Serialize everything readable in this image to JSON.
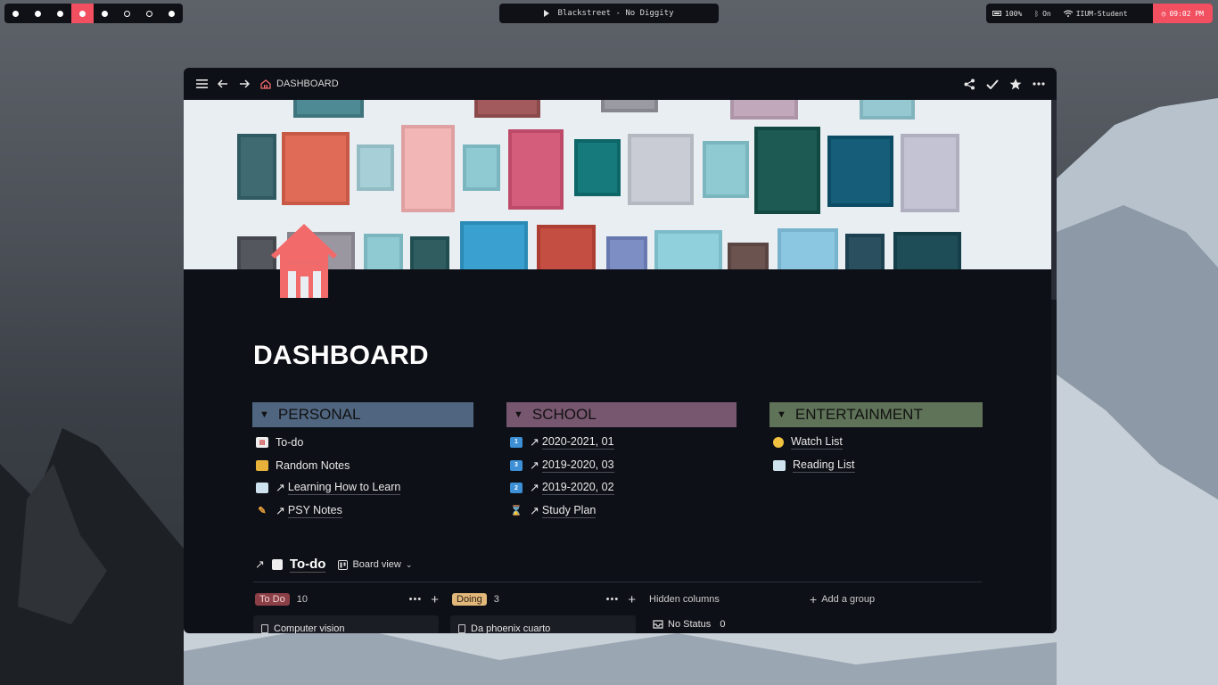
{
  "topbar": {
    "workspaces": [
      {
        "state": "filled"
      },
      {
        "state": "filled"
      },
      {
        "state": "filled"
      },
      {
        "state": "active"
      },
      {
        "state": "filled"
      },
      {
        "state": "hollow"
      },
      {
        "state": "hollow"
      },
      {
        "state": "filled"
      }
    ],
    "now_playing": "Blackstreet - No Diggity",
    "battery": "100%",
    "bluetooth": "On",
    "wifi": "IIUM-Student",
    "clock": "09:02 PM",
    "accent_color": "#f25060"
  },
  "window": {
    "breadcrumb": "DASHBOARD",
    "icons": [
      "menu-icon",
      "back-icon",
      "forward-icon",
      "home-icon",
      "share-icon",
      "check-icon",
      "star-icon",
      "more-icon"
    ]
  },
  "page": {
    "title": "DASHBOARD",
    "sections": [
      {
        "title": "PERSONAL",
        "color": "#4f6580",
        "items": [
          {
            "emoji": "clipboard-icon",
            "link": false,
            "label": "To-do"
          },
          {
            "emoji": "notebook-icon",
            "link": false,
            "label": "Random Notes"
          },
          {
            "emoji": "book-icon",
            "link": true,
            "label": "Learning How to Learn"
          },
          {
            "emoji": "pencil-icon",
            "link": true,
            "label": "PSY Notes"
          }
        ]
      },
      {
        "title": "SCHOOL",
        "color": "#77566f",
        "items": [
          {
            "emoji": "keycap-1-icon",
            "link": true,
            "label": "2020-2021, 01"
          },
          {
            "emoji": "keycap-3-icon",
            "link": true,
            "label": "2019-2020, 03"
          },
          {
            "emoji": "keycap-2-icon",
            "link": true,
            "label": "2019-2020, 02"
          },
          {
            "emoji": "hourglass-icon",
            "link": true,
            "label": "Study Plan"
          }
        ]
      },
      {
        "title": "ENTERTAINMENT",
        "color": "#5f7358",
        "items": [
          {
            "emoji": "popcorn-icon",
            "link": false,
            "label": "Watch List"
          },
          {
            "emoji": "book-icon",
            "link": false,
            "label": "Reading List"
          }
        ]
      }
    ],
    "board": {
      "title": "To-do",
      "view": "Board view",
      "columns": [
        {
          "tag": "To Do",
          "tag_color": "#8b3f47",
          "count": "10",
          "first_card": "Computer vision"
        },
        {
          "tag": "Doing",
          "tag_color": "#e2b77a",
          "count": "3",
          "first_card": "Da phoenix cuarto"
        }
      ],
      "hidden_columns_label": "Hidden columns",
      "no_status_label": "No Status",
      "no_status_count": "0",
      "add_group_label": "Add a group"
    }
  }
}
